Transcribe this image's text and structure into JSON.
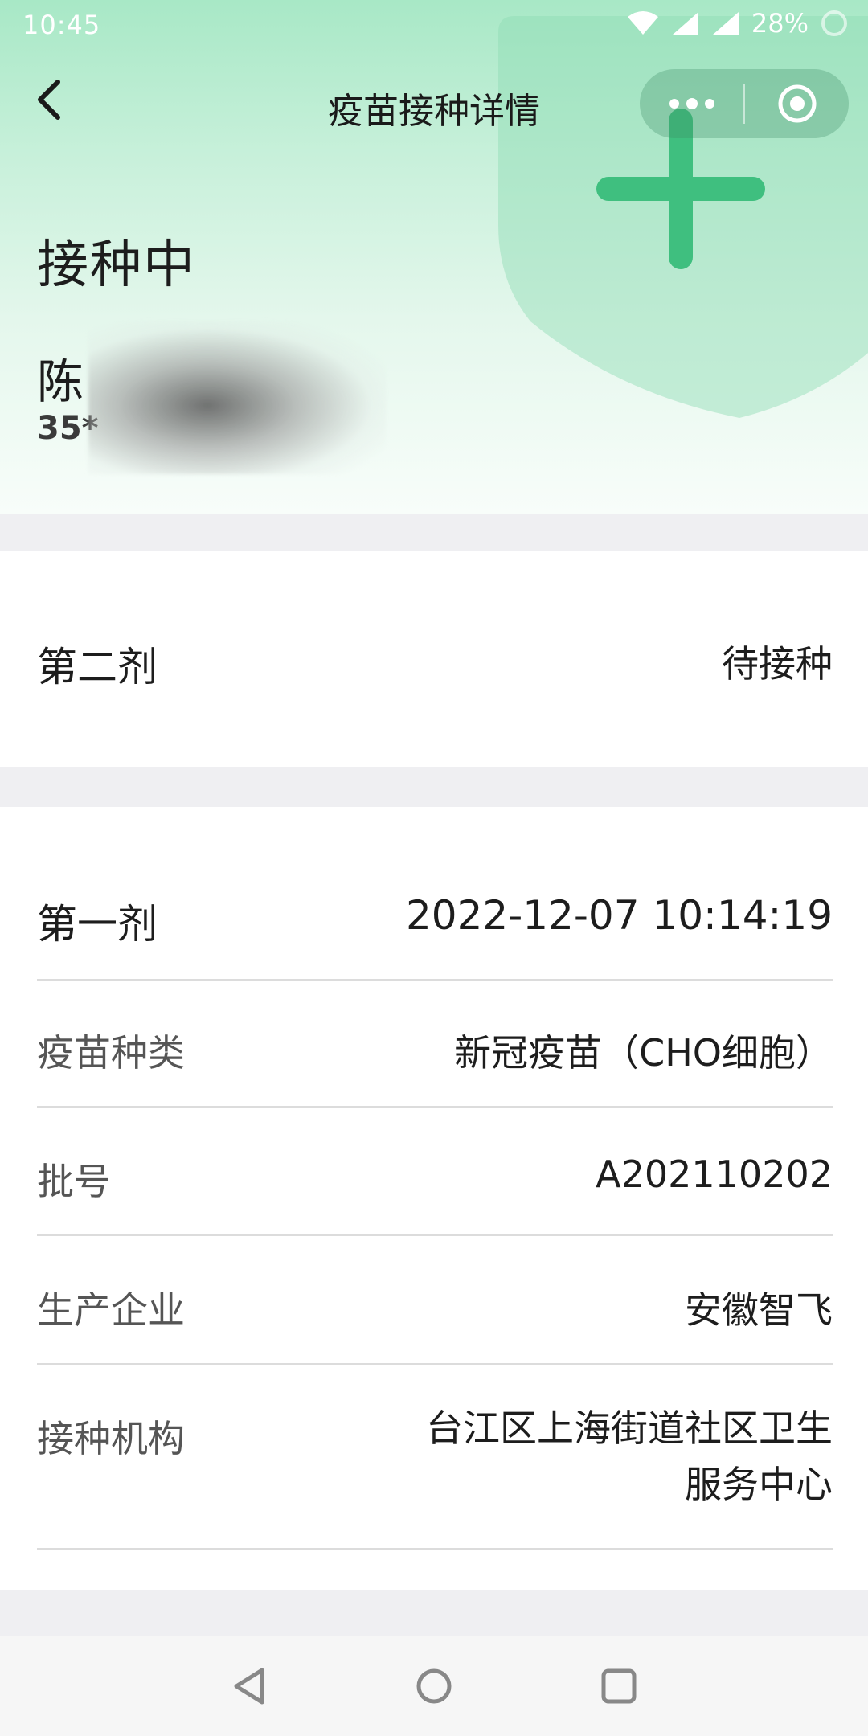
{
  "status_bar": {
    "time": "10:45",
    "battery": "28%",
    "icons": [
      "wifi-icon",
      "signal-icon",
      "signal-icon",
      "battery-icon"
    ]
  },
  "nav": {
    "title": "疫苗接种详情",
    "back_icon": "chevron-left-icon",
    "capsule_icons": [
      "more-dots-icon",
      "target-close-icon"
    ]
  },
  "hero": {
    "status": "接种中",
    "name": "陈",
    "id_prefix": "35*"
  },
  "second_dose": {
    "label": "第二剂",
    "value": "待接种"
  },
  "first_dose": {
    "label": "第一剂",
    "value": "2022-12-07 10:14:19",
    "details": [
      {
        "label": "疫苗种类",
        "value": "新冠疫苗（CHO细胞）"
      },
      {
        "label": "批号",
        "value": "A202110202"
      },
      {
        "label": "生产企业",
        "value": "安徽智飞"
      },
      {
        "label": "接种机构",
        "value_line1": "台江区上海街道社区卫生",
        "value_line2": "服务中心"
      }
    ]
  },
  "system_nav": [
    "back-triangle-icon",
    "home-circle-icon",
    "recents-square-icon"
  ],
  "colors": {
    "accent_green": "#3fbf7f",
    "hero_top": "#a8e8c6",
    "page_bg": "#efeff2"
  }
}
